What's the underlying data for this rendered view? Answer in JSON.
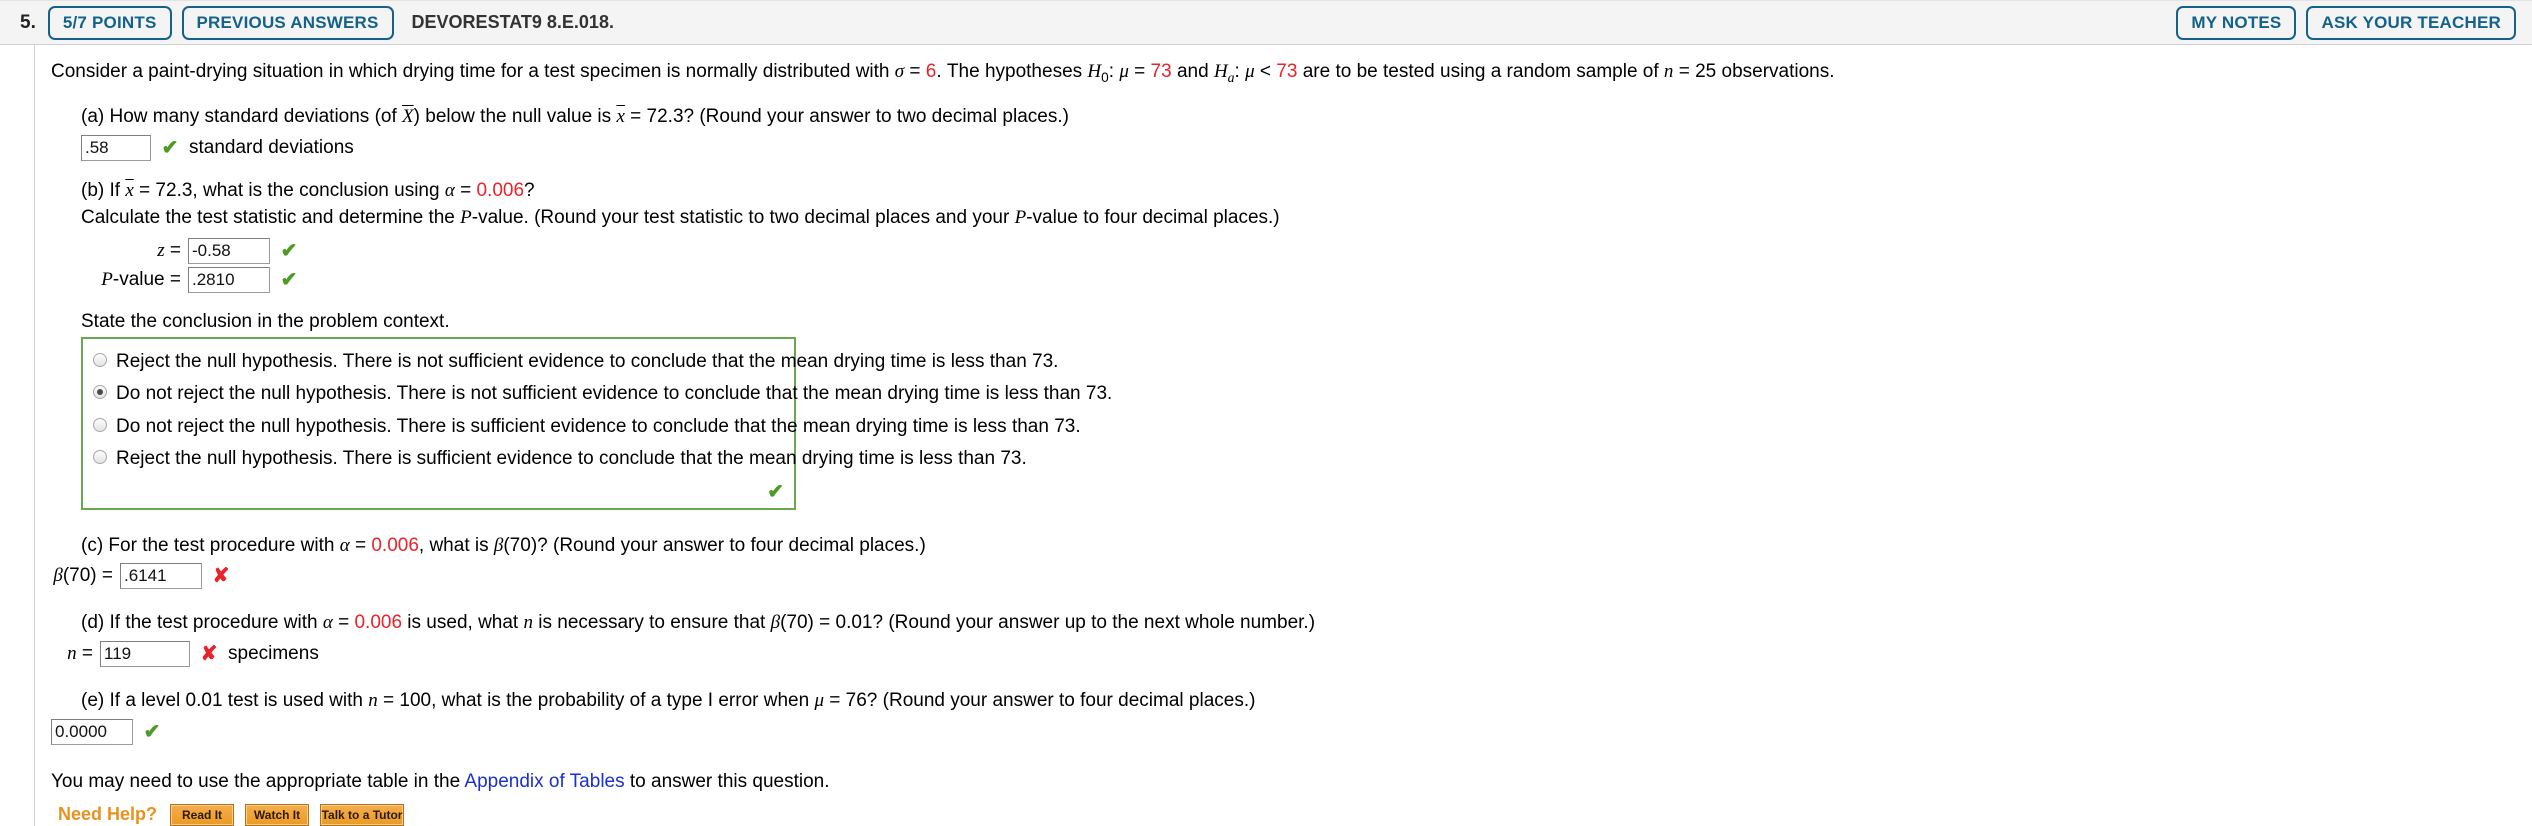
{
  "header": {
    "question_number": "5.",
    "points_badge": "5/7 POINTS",
    "previous_answers_badge": "PREVIOUS ANSWERS",
    "question_code": "DEVORESTAT9 8.E.018.",
    "my_notes_button": "MY NOTES",
    "ask_teacher_button": "ASK YOUR TEACHER",
    "accent_blue": "#14628c"
  },
  "prompt": {
    "seg1": "Consider a paint-drying situation in which drying time for a test specimen is normally distributed with ",
    "sigma": "σ",
    "eq1": " = ",
    "sigma_value": "6",
    "seg2": ". The hypotheses ",
    "h0": "H",
    "h0_sub": "0",
    "h0_rest": ": ",
    "mu": "μ",
    "mu_eq": " = ",
    "mu_value": "73",
    "seg3": " and ",
    "ha": "H",
    "ha_sub": "a",
    "ha_rest": ": ",
    "mu2": "μ",
    "lt": " < ",
    "mu_value2": "73",
    "seg4": " are to be tested using a random sample of ",
    "n": "n",
    "n_eq": " = ",
    "n_value": "25",
    "seg5": " observations."
  },
  "part_a": {
    "text_pre": "(a) How many standard deviations (of ",
    "xbar_cap": "X",
    "text_mid": ") below the null value is ",
    "xbar": "x",
    "text_post": " = 72.3? (Round your answer to two decimal places.)",
    "answer_value": ".58",
    "mark": "✔",
    "mark_status": "correct",
    "unit": "standard deviations"
  },
  "part_b": {
    "line1_pre": "(b) If ",
    "line1_xbar": "x",
    "line1_mid": " = 72.3, what is the conclusion using ",
    "alpha": "α",
    "line1_eq": " = ",
    "alpha_value": "0.006",
    "line1_post": "?",
    "line2": "Calculate the test statistic and determine the P-value. (Round your test statistic to two decimal places and your P-value to four decimal places.)",
    "line2_a": "Calculate the test statistic and determine the ",
    "line2_P1": "P",
    "line2_b": "-value. (Round your test statistic to two decimal places and your ",
    "line2_P2": "P",
    "line2_c": "-value to four decimal places.)",
    "z_label": "z",
    "z_eq": " = ",
    "z_value": "-0.58",
    "z_mark": "✔",
    "z_mark_status": "correct",
    "pvalue_label": "P",
    "pvalue_label_rest": "-value  = ",
    "pvalue_value": ".2810",
    "pvalue_mark": "✔",
    "pvalue_mark_status": "correct"
  },
  "conclusion": {
    "prompt": "State the conclusion in the problem context.",
    "options": [
      {
        "text": "Reject the null hypothesis. There is not sufficient evidence to conclude that the mean drying time is less than 73.",
        "selected": false
      },
      {
        "text": "Do not reject the null hypothesis. There is not sufficient evidence to conclude that the mean drying time is less than 73.",
        "selected": true
      },
      {
        "text": "Do not reject the null hypothesis. There is sufficient evidence to conclude that the mean drying time is less than 73.",
        "selected": false
      },
      {
        "text": "Reject the null hypothesis. There is sufficient evidence to conclude that the mean drying time is less than 73.",
        "selected": false
      }
    ],
    "box_mark": "✔",
    "box_mark_status": "correct",
    "box_border_color": "#6aa84f"
  },
  "part_c": {
    "line_pre": "(c) For the test procedure with ",
    "alpha": "α",
    "eq": " = ",
    "alpha_value": "0.006",
    "line_mid": ", what is ",
    "beta": "β",
    "line_post": "(70)? (Round your answer to four decimal places.)",
    "ans_label_beta": "β",
    "ans_label_rest": "(70) = ",
    "answer_value": ".6141",
    "mark": "✘",
    "mark_status": "incorrect"
  },
  "part_d": {
    "line_pre": "(d) If the test procedure with ",
    "alpha": "α",
    "eq": " = ",
    "alpha_value": "0.006",
    "line_mid": " is used, what ",
    "n": "n",
    "line_mid2": " is necessary to ensure that ",
    "beta": "β",
    "line_post": "(70) = 0.01? (Round your answer up to the next whole number.)",
    "ans_label_n": "n",
    "ans_label_rest": " = ",
    "answer_value": "119",
    "mark": "✘",
    "mark_status": "incorrect",
    "unit": "specimens"
  },
  "part_e": {
    "line_pre": "(e) If a level 0.01 test is used with ",
    "n": "n",
    "eq": " = 100, what is the probability of a type I error when ",
    "mu": "μ",
    "line_post": " = 76? (Round your answer to four decimal places.)",
    "answer_value": "0.0000",
    "mark": "✔",
    "mark_status": "correct"
  },
  "footer": {
    "note_pre": "You may need to use the appropriate table in the ",
    "link_text": "Appendix of Tables",
    "note_post": " to answer this question.",
    "need_help_label": "Need Help?",
    "help_buttons": [
      "Read It",
      "Watch It",
      "Talk to a Tutor"
    ],
    "link_color": "#1a2fd0",
    "need_help_color": "#e8921d"
  }
}
